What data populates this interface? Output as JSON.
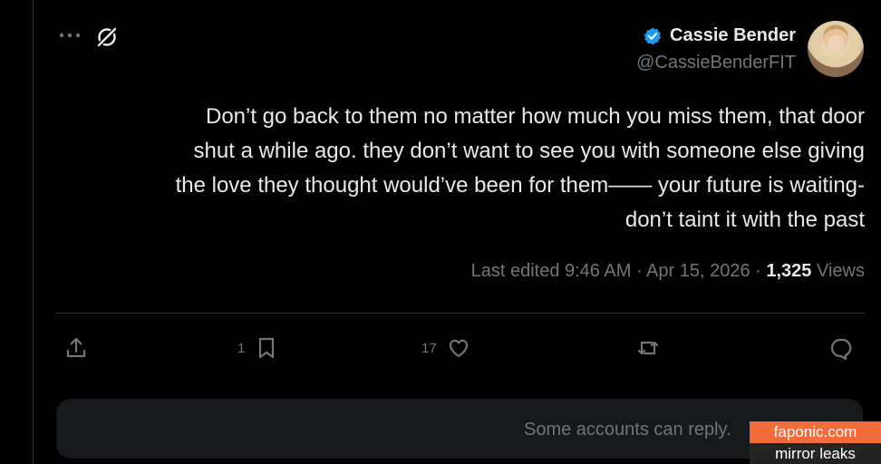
{
  "author": {
    "name": "Cassie Bender",
    "handle": "@CassieBenderFIT"
  },
  "tweet": {
    "lines": [
      "Don’t go back to them no matter how much you miss them, that door",
      "shut a while ago. they don’t want to see you with someone else giving",
      "the love they thought would’ve been for them—— your future is waiting-",
      "don’t taint it with the past"
    ],
    "edited_label": "Last edited 9:46 AM · Apr 15, 2026 ·",
    "views_count": "1,325",
    "views_label": "Views"
  },
  "actions": {
    "bookmarks_count": "1",
    "likes_count": "17"
  },
  "reply": {
    "text": "Some accounts can reply."
  },
  "watermark": {
    "line1": "faponic.com",
    "line2": "mirror leaks"
  },
  "colors": {
    "background": "#000000",
    "text": "#e7e9ea",
    "muted": "#71767b",
    "verified": "#1d9bf0",
    "watermark_orange": "#f26b3a"
  },
  "icons": [
    "verified-badge-icon",
    "grok-icon",
    "more-icon",
    "share-icon",
    "bookmark-icon",
    "like-icon",
    "retweet-icon",
    "reply-icon"
  ]
}
